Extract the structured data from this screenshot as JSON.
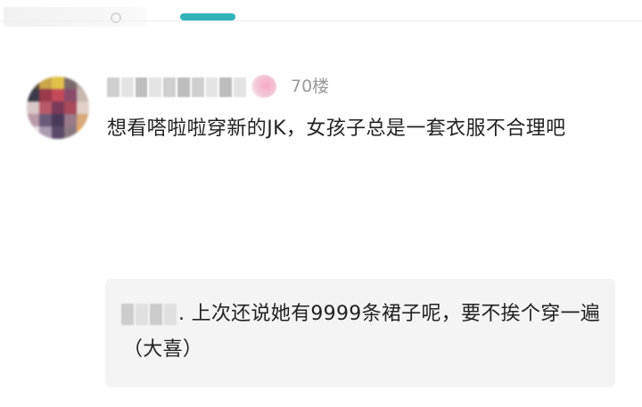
{
  "colors": {
    "accent": "#2fb3b8",
    "text_primary": "#222222",
    "text_secondary": "#9a9a9a",
    "reply_background": "#f4f4f4"
  },
  "top_bar": {
    "active_tab_indicator": "accent"
  },
  "comment": {
    "username": "",
    "floor": "70楼",
    "avatar_icon": "avatar-blurred",
    "badge_icon": "fan-badge-icon",
    "text": "想看嗒啦啦穿新的JK，女孩子总是一套衣服不合理吧",
    "reply": {
      "username": "",
      "text": ". 上次还说她有9999条裙子呢，要不挨个穿一遍（大喜）"
    }
  }
}
